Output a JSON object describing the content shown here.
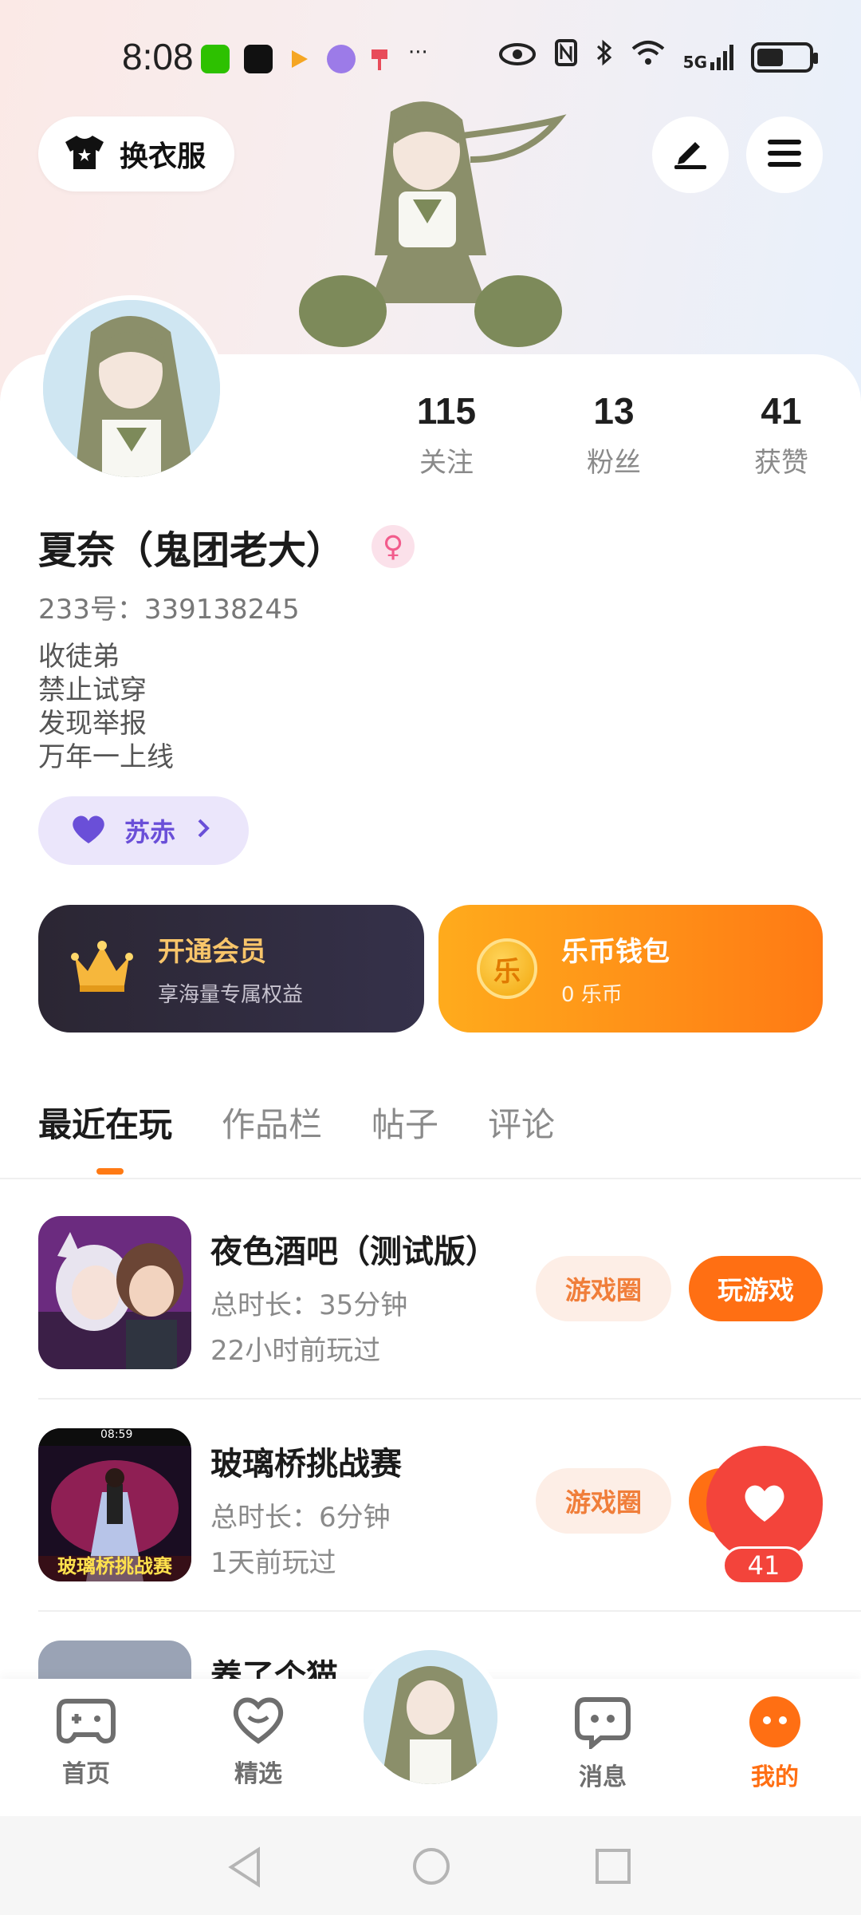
{
  "status_bar": {
    "time": "8:08",
    "more": "···",
    "network": "5G"
  },
  "header": {
    "dress_label": "换衣服",
    "edit_icon": "pencil-icon",
    "menu_icon": "hamburger-icon"
  },
  "profile": {
    "stats": [
      {
        "value": "115",
        "label": "关注"
      },
      {
        "value": "13",
        "label": "粉丝"
      },
      {
        "value": "41",
        "label": "获赞"
      }
    ],
    "name": "夏奈（鬼团老大）",
    "gender_symbol": "♀",
    "uid": "233号：339138245",
    "bio": [
      "收徒弟",
      "禁止试穿",
      "发现举报",
      "万年一上线"
    ],
    "cp_label": "苏赤"
  },
  "cards": {
    "vip": {
      "title": "开通会员",
      "subtitle": "享海量专属权益"
    },
    "wallet": {
      "title": "乐币钱包",
      "subtitle": "0 乐币",
      "coin_char": "乐"
    }
  },
  "tabs": [
    "最近在玩",
    "作品栏",
    "帖子",
    "评论"
  ],
  "games": [
    {
      "title": "夜色酒吧（测试版）",
      "duration": "总时长：35分钟",
      "last_played": "22小时前玩过",
      "circle_label": "游戏圈",
      "play_label": "玩游戏"
    },
    {
      "title": "玻璃桥挑战赛",
      "duration": "总时长：6分钟",
      "last_played": "1天前玩过",
      "circle_label": "游戏圈",
      "thumb_overlay": "玻璃桥挑战赛",
      "thumb_time": "08:59"
    },
    {
      "title": "养了个猫"
    }
  ],
  "like_badge": {
    "count": "41"
  },
  "bottom_nav": [
    {
      "label": "首页"
    },
    {
      "label": "精选"
    },
    {
      "label": "消息"
    },
    {
      "label": "我的"
    }
  ],
  "colors": {
    "accent": "#ff6f13",
    "like": "#f3443b",
    "cp": "#6a4fd8"
  }
}
